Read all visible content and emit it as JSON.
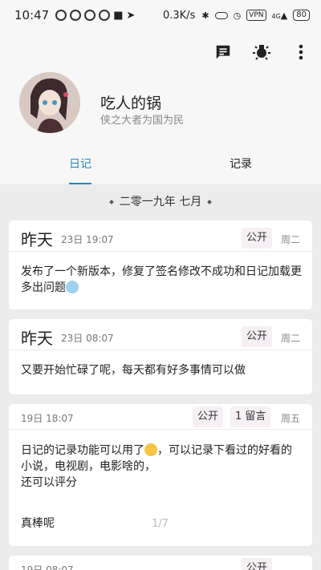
{
  "status_bar": {
    "time": "10:47",
    "net_speed": "0.3K/s",
    "vpn": "VPN",
    "signal": "4G",
    "battery": "80"
  },
  "toolbar": {
    "icons": [
      "message-icon",
      "lightbulb-icon",
      "more-vert-icon"
    ]
  },
  "profile": {
    "name": "吃人的锅",
    "signature": "侠之大者为国为民"
  },
  "tabs": [
    {
      "label": "日记",
      "active": true
    },
    {
      "label": "记录",
      "active": false
    }
  ],
  "month_header": "二零一九年 七月",
  "cards": [
    {
      "day": "昨天",
      "time": "23日 19:07",
      "visibility": "公开",
      "weekday": "周二",
      "text": "发布了一个新版本，修复了签名修改不成功和日记加载更多出问题"
    },
    {
      "day": "昨天",
      "time": "23日 08:07",
      "visibility": "公开",
      "weekday": "周二",
      "text": "又要开始忙碌了呢，每天都有好多事情可以做"
    },
    {
      "time": "19日 18:07",
      "visibility": "公开",
      "comments": "1 留言",
      "weekday": "周五",
      "line1a": "日记的记录功能可以用了",
      "line1b": "，可以记录下看过的好看的小说，电视剧，电影啥的，",
      "line2": "还可以评分",
      "line3": "真棒呢",
      "page": "1/7"
    },
    {
      "time": "19日 08:07",
      "visibility": "公开"
    }
  ]
}
